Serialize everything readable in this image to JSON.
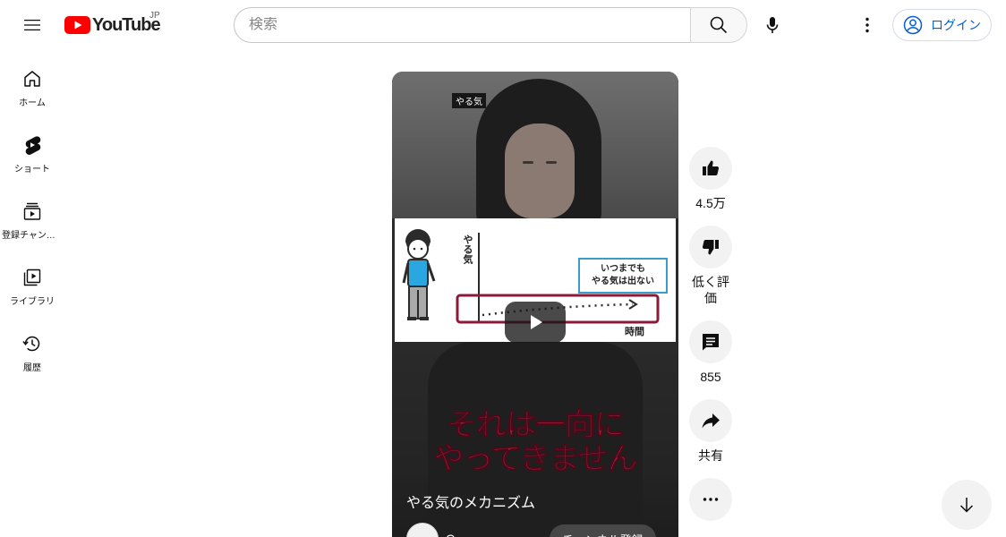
{
  "header": {
    "logo_text": "YouTube",
    "region": "JP",
    "search_placeholder": "検索",
    "signin_label": "ログイン",
    "brand_red": "#ff0000",
    "accent_blue": "#065fd4"
  },
  "guide": {
    "items": [
      {
        "label": "ホーム",
        "icon": "home-icon"
      },
      {
        "label": "ショート",
        "icon": "shorts-icon"
      },
      {
        "label": "登録チャンネル",
        "icon": "subscriptions-icon"
      },
      {
        "label": "ライブラリ",
        "icon": "library-icon"
      },
      {
        "label": "履歴",
        "icon": "history-icon"
      }
    ]
  },
  "short": {
    "topic_tag": "やる気",
    "diagram": {
      "ylabel": "やる気",
      "xlabel": "時間",
      "callout": [
        "いつまでも",
        "やる気は出ない"
      ]
    },
    "caption": [
      "それは一向に",
      "やってきません"
    ],
    "title": "やる気のメカニズム",
    "channel_name": "C",
    "subscribe_label": "チャンネル登録"
  },
  "actions": {
    "like_count": "4.5万",
    "dislike_label": "低く評価",
    "comment_count": "855",
    "share_label": "共有"
  }
}
